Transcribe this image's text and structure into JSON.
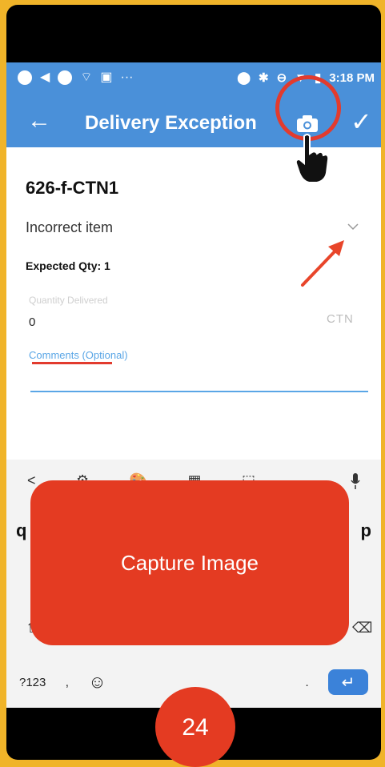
{
  "status_bar": {
    "time": "3:18 PM",
    "icons": [
      "circle-icon",
      "back-triangle-icon",
      "circle-icon",
      "wifi-icon",
      "image-icon",
      "more-icon",
      "location-icon",
      "bluetooth-icon",
      "minus-circle-icon",
      "signal-icon",
      "sim-icon",
      "battery-icon"
    ]
  },
  "app_bar": {
    "title": "Delivery Exception",
    "back_icon": "back-arrow-icon",
    "camera_icon": "camera-icon",
    "confirm_icon": "check-icon",
    "color": "#4a90d9"
  },
  "form": {
    "code": "626-f-CTN1",
    "reason": "Incorrect item",
    "expected_qty": "Expected Qty: 1",
    "quantity_label": "Quantity Delivered",
    "quantity_value": "0",
    "unit": "CTN",
    "comments_placeholder": "Comments (Optional)"
  },
  "keyboard": {
    "top_row": [
      "<",
      "⚙",
      "🎨",
      "▦",
      "⬚",
      "···",
      "mic"
    ],
    "letters_left": "q",
    "letters_right": "p",
    "bottom_row": {
      "num_key": "?123",
      "comma": ",",
      "emoji": "☺",
      "period": ".",
      "enter": "↵"
    }
  },
  "overlay": {
    "capture_label": "Capture Image",
    "page_number": "24",
    "accent": "#e43b22",
    "frame_color": "#f0b429"
  }
}
